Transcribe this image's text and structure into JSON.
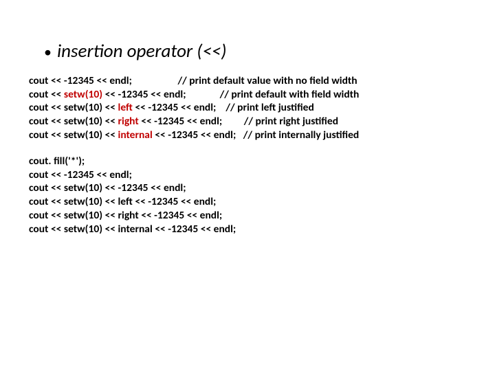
{
  "heading": "insertion operator (<<)",
  "block1": {
    "l1a": "cout << -12345 << endl;                   ",
    "l1b": "// print default value with no field width",
    "l2a": "cout << ",
    "l2b": "setw(10)",
    "l2c": " << -12345 << endl;              ",
    "l2d": "// print default with field width",
    "l3a": "cout << setw(10) << ",
    "l3b": "left",
    "l3c": " << -12345 << endl;    ",
    "l3d": "// print left justified",
    "l4a": "cout << setw(10) << ",
    "l4b": "right",
    "l4c": " << -12345 << endl;         ",
    "l4d": "// print right justified",
    "l5a": "cout << setw(10) << ",
    "l5b": "internal",
    "l5c": " << -12345 << endl;   ",
    "l5d": "// print internally justified"
  },
  "block2": {
    "l1": "cout. fill('*');",
    "l2": "cout << -12345 << endl;",
    "l3": "cout << setw(10) << -12345 << endl;",
    "l4": "cout << setw(10) << left << -12345 << endl;",
    "l5": "cout << setw(10) << right << -12345 << endl;",
    "l6": "cout << setw(10) << internal << -12345 << endl;"
  }
}
